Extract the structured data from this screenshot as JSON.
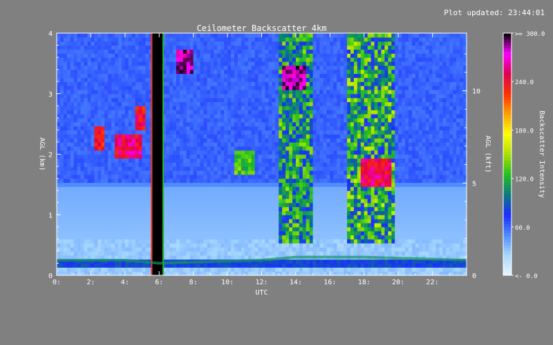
{
  "plot_updated": "Plot updated: 23:44:01",
  "chart_data": {
    "type": "heatmap",
    "title": "Ceilometer Backscatter 4km",
    "xlabel": "UTC",
    "ylabel_left": "AGL (km)",
    "ylabel_right": "AGL (kft)",
    "xlim": [
      0,
      24
    ],
    "ylim_km": [
      0,
      4
    ],
    "ylim_kft": [
      0,
      13.123
    ],
    "x_ticks": [
      0,
      2,
      4,
      6,
      8,
      10,
      12,
      14,
      16,
      18,
      20,
      22
    ],
    "x_tick_labels": [
      "0:",
      "2:",
      "4:",
      "6:",
      "8:",
      "10:",
      "12:",
      "14:",
      "16:",
      "18:",
      "20:",
      "22:"
    ],
    "y_ticks_km": [
      0,
      1,
      2,
      3,
      4
    ],
    "y_tick_labels_km": [
      "0",
      "1",
      "2",
      "3",
      "4"
    ],
    "y_ticks_kft": [
      0,
      5,
      10
    ],
    "y_tick_labels_kft": [
      "0",
      "5",
      "10"
    ],
    "colorbar": {
      "label": "Backscatter Intensity",
      "range": [
        0,
        300
      ],
      "tick_values": [
        0,
        60,
        120,
        180,
        240,
        300
      ],
      "tick_labels": [
        "<-   0.0",
        "60.0",
        "120.0",
        "180.0",
        "240.0",
        ">= 300.0"
      ],
      "colors": [
        "#e8f4ff",
        "#a8d8ff",
        "#4f8cff",
        "#1a2dff",
        "#0a7a80",
        "#22c022",
        "#a8e000",
        "#ffff00",
        "#ffa000",
        "#ff3000",
        "#e00050",
        "#ff00ff",
        "#000000"
      ]
    },
    "features": {
      "boundary_layer": [
        {
          "x": 0,
          "height_km": 0.25,
          "intensity": 80
        },
        {
          "x": 4,
          "height_km": 0.25,
          "intensity": 90
        },
        {
          "x": 6,
          "height_km": 0.2,
          "intensity": 70
        },
        {
          "x": 12,
          "height_km": 0.25,
          "intensity": 90
        },
        {
          "x": 14,
          "height_km": 0.3,
          "intensity": 110
        },
        {
          "x": 18,
          "height_km": 0.3,
          "intensity": 90
        },
        {
          "x": 24,
          "height_km": 0.25,
          "intensity": 80
        }
      ],
      "precipitation_column": {
        "x_start": 5.6,
        "x_end": 6.2,
        "height_range_km": [
          0,
          4
        ]
      },
      "cloud_layers": [
        {
          "x_start": 2.2,
          "x_end": 2.8,
          "height_km": 2.3,
          "intensity": 250
        },
        {
          "x_start": 3.5,
          "x_end": 5.0,
          "height_km": 2.1,
          "intensity": 270
        },
        {
          "x_start": 4.6,
          "x_end": 5.3,
          "height_km": 2.6,
          "intensity": 260
        },
        {
          "x_start": 7.0,
          "x_end": 8.0,
          "height_km": 3.5,
          "intensity": 300
        },
        {
          "x_start": 13.3,
          "x_end": 14.6,
          "height_km": 3.25,
          "intensity": 300
        },
        {
          "x_start": 17.8,
          "x_end": 19.5,
          "height_km": 1.7,
          "intensity": 270
        },
        {
          "x_start": 10.5,
          "x_end": 11.5,
          "height_km": 1.9,
          "intensity": 150
        }
      ],
      "noise_columns": [
        {
          "x_start": 13.0,
          "x_end": 15.0,
          "intensity": 140
        },
        {
          "x_start": 17.0,
          "x_end": 19.8,
          "intensity": 150
        }
      ]
    }
  }
}
